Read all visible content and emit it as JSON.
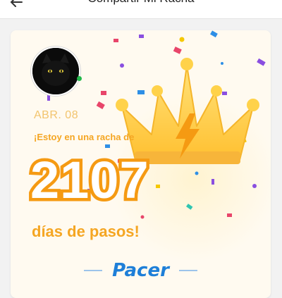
{
  "header": {
    "title": "Compartir Mi Racha"
  },
  "share_card": {
    "date": "ABR. 08",
    "streak_intro": "¡Estoy en una racha de",
    "streak_count": "2107",
    "streak_unit": "días de pasos!",
    "brand": "Pacer",
    "icons": [
      "back-arrow-icon",
      "avatar-cat",
      "crown-icon",
      "lightning-icon",
      "confetti"
    ],
    "colors": {
      "accent_orange": "#f5a623",
      "crown_gold": "#ffd24a",
      "brand_blue": "#1e7fd8",
      "date_color": "#f2c46e"
    }
  }
}
